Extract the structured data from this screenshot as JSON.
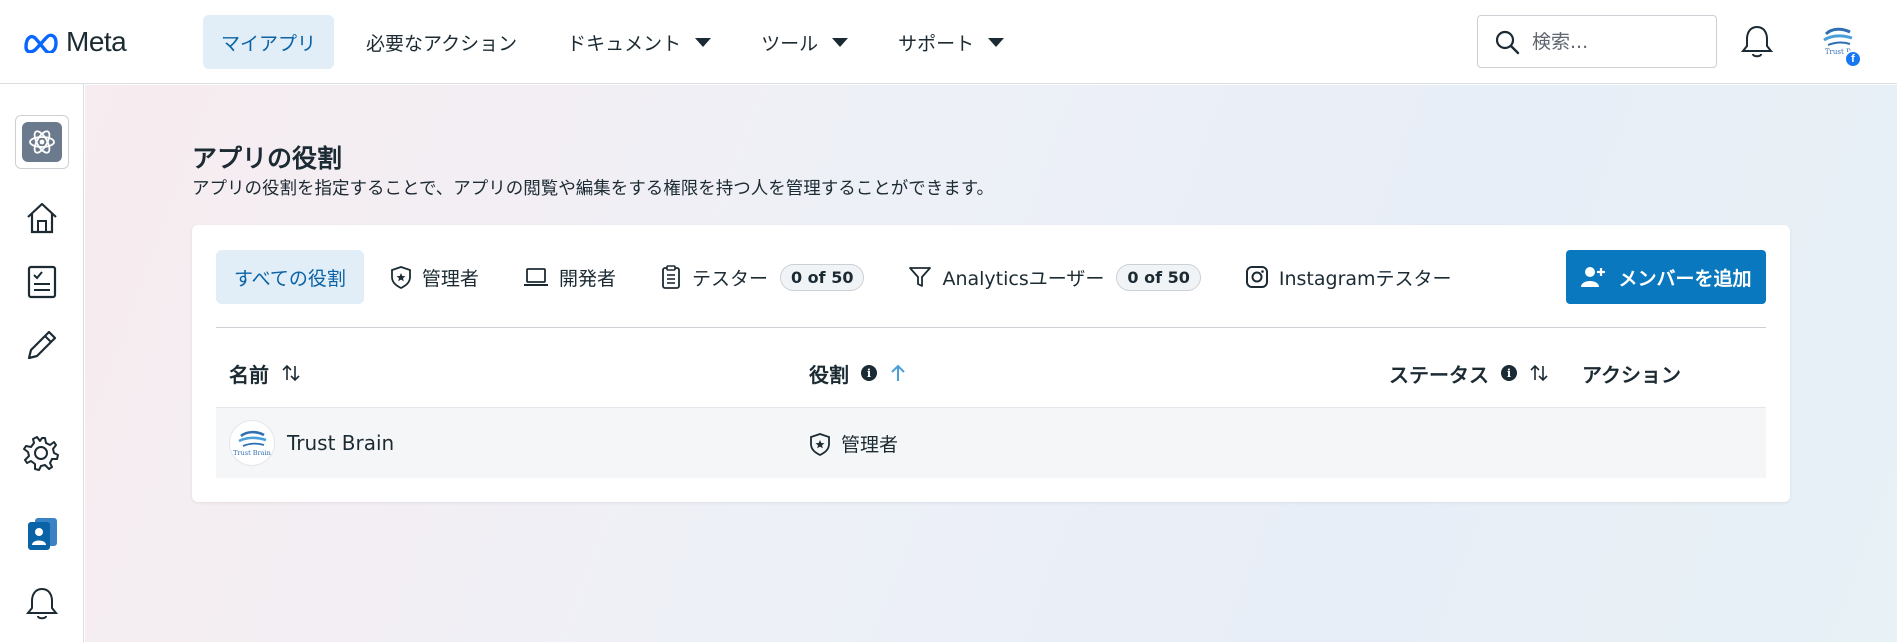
{
  "header": {
    "logo_text": "Meta",
    "nav": [
      {
        "label": "マイアプリ"
      },
      {
        "label": "必要なアクション"
      },
      {
        "label": "ドキュメント"
      },
      {
        "label": "ツール"
      },
      {
        "label": "サポート"
      }
    ],
    "search_placeholder": "検索...",
    "avatar_label": "Trust B"
  },
  "page": {
    "title": "アプリの役割",
    "description": "アプリの役割を指定することで、アプリの閲覧や編集をする権限を持つ人を管理することができます。"
  },
  "tabs": [
    {
      "label": "すべての役割"
    },
    {
      "label": "管理者"
    },
    {
      "label": "開発者"
    },
    {
      "label": "テスター",
      "count": "0 of 50"
    },
    {
      "label": "Analyticsユーザー",
      "count": "0 of 50"
    },
    {
      "label": "Instagramテスター"
    }
  ],
  "add_button": "メンバーを追加",
  "table": {
    "columns": [
      "名前",
      "役割",
      "ステータス",
      "アクション"
    ],
    "rows": [
      {
        "name": "Trust Brain",
        "avatar_text": "Trust Brain",
        "role": "管理者",
        "status": "",
        "action": ""
      }
    ]
  },
  "colors": {
    "accent": "#0a78be",
    "active_tab_bg": "#e1edf7",
    "active_text": "#0a63a6",
    "sort_active": "#4a9fd8"
  }
}
